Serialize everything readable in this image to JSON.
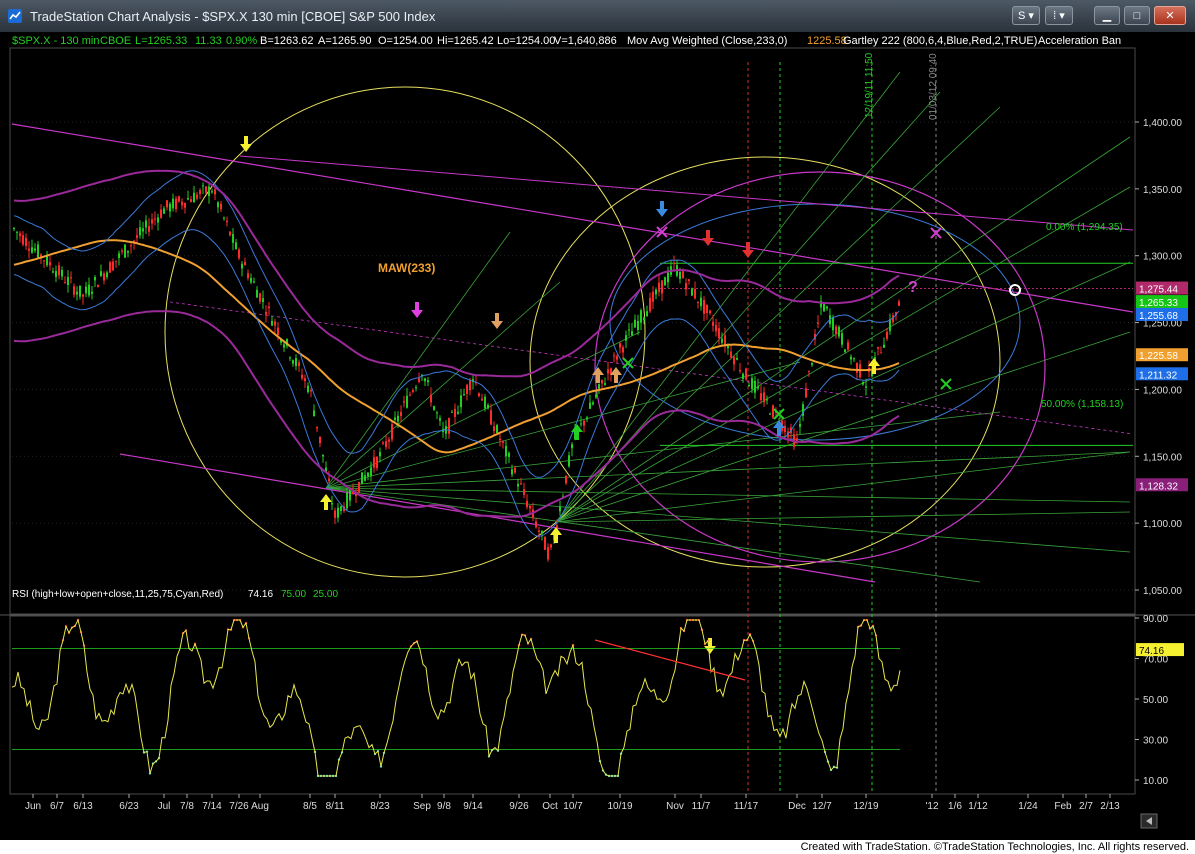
{
  "window": {
    "title": "TradeStation Chart Analysis - $SPX.X 130 min [CBOE] S&P 500 Index",
    "buttons": {
      "symbol_menu": "S ▾",
      "study_menu": "⁞ ▾",
      "minimize": "▁",
      "maximize": "□",
      "close": "✕"
    }
  },
  "header": {
    "symbol": "$SPX.X - 130 min",
    "exchange": "CBOE",
    "last": "L=1265.33",
    "change": "11.33",
    "change_pct": "0.90%",
    "bid": "B=1263.62",
    "ask": "A=1265.90",
    "open": "O=1254.00",
    "high": "Hi=1265.42",
    "low": "Lo=1254.00",
    "volume": "V=1,640,886",
    "mov_avg": "Mov Avg Weighted (Close,233,0)",
    "mov_avg_value": "1225.58",
    "gartley": "Gartley 222 (800,6,4,Blue,Red,2,TRUE)",
    "accel": "Acceleration Ban"
  },
  "price_panel": {
    "labels": {
      "maw": "MAW(233)",
      "fib_top": "0.00% (1,294.35)",
      "fib_mid": "50.00% (1,158.13)",
      "question": "?",
      "vline1": "12/19/11 11:50",
      "vline2": "01/03/12 09:40"
    },
    "axis_ticks": [
      {
        "label": "1,400.00",
        "value": 1400
      },
      {
        "label": "1,350.00",
        "value": 1350
      },
      {
        "label": "1,300.00",
        "value": 1300
      },
      {
        "label": "1,250.00",
        "value": 1250
      },
      {
        "label": "1,200.00",
        "value": 1200
      },
      {
        "label": "1,150.00",
        "value": 1150
      },
      {
        "label": "1,100.00",
        "value": 1100
      },
      {
        "label": "1,050.00",
        "value": 1050
      }
    ],
    "tags": [
      {
        "label": "1,275.44",
        "value": 1275.44,
        "color": "#b02a6a"
      },
      {
        "label": "1,265.33",
        "value": 1265.33,
        "color": "#15c415"
      },
      {
        "label": "1,255.68",
        "value": 1255.68,
        "color": "#1e6ee8"
      },
      {
        "label": "1,225.58",
        "value": 1225.58,
        "color": "#f0a030"
      },
      {
        "label": "1,211.32",
        "value": 1211.32,
        "color": "#1e6ee8"
      },
      {
        "label": "1,128.32",
        "value": 1128.32,
        "color": "#8a1f7a"
      }
    ]
  },
  "rsi_panel": {
    "title": "RSI (high+low+open+close,11,25,75,Cyan,Red)",
    "value": "74.16",
    "overbought": "75.00",
    "oversold": "25.00",
    "axis_ticks": [
      {
        "label": "90.00",
        "value": 90
      },
      {
        "label": "70.00",
        "value": 70
      },
      {
        "label": "50.00",
        "value": 50
      },
      {
        "label": "30.00",
        "value": 30
      },
      {
        "label": "10.00",
        "value": 10
      }
    ],
    "tag": {
      "label": "74.16",
      "value": 74.16
    }
  },
  "x_axis": [
    "Jun",
    "6/7",
    "6/13",
    "6/23",
    "Jul",
    "7/8",
    "7/14",
    "7/26",
    "Aug",
    "8/5",
    "8/11",
    "8/23",
    "Sep",
    "9/8",
    "9/14",
    "9/26",
    "Oct",
    "10/7",
    "10/19",
    "Nov",
    "11/7",
    "11/17",
    "Dec",
    "12/7",
    "12/19",
    "'12",
    "1/6",
    "1/12",
    "1/24",
    "Feb",
    "2/7",
    "2/13"
  ],
  "chart_data": {
    "type": "candlestick",
    "title": "$SPX.X 130 min [CBOE] S&P 500 Index",
    "ylim": [
      1020,
      1440
    ],
    "key_levels": [
      {
        "label": "0.00%",
        "value": 1294.35
      },
      {
        "label": "50.00%",
        "value": 1158.13
      }
    ],
    "anchor_points": [
      {
        "x": "Jun",
        "y": 1320
      },
      {
        "x": "6/13",
        "y": 1270
      },
      {
        "x": "Jul",
        "y": 1335
      },
      {
        "x": "7/14",
        "y": 1350
      },
      {
        "x": "7/26",
        "y": 1300
      },
      {
        "x": "8/5",
        "y": 1200
      },
      {
        "x": "8/11",
        "y": 1105
      },
      {
        "x": "8/23",
        "y": 1150
      },
      {
        "x": "Sep",
        "y": 1215
      },
      {
        "x": "9/8",
        "y": 1165
      },
      {
        "x": "9/14",
        "y": 1210
      },
      {
        "x": "9/26",
        "y": 1130
      },
      {
        "x": "Oct",
        "y": 1075
      },
      {
        "x": "10/7",
        "y": 1160
      },
      {
        "x": "10/19",
        "y": 1230
      },
      {
        "x": "Nov",
        "y": 1292
      },
      {
        "x": "11/7",
        "y": 1265
      },
      {
        "x": "11/17",
        "y": 1210
      },
      {
        "x": "Dec",
        "y": 1160
      },
      {
        "x": "12/7",
        "y": 1265
      },
      {
        "x": "12/19",
        "y": 1205
      },
      {
        "x": "'12",
        "y": 1265
      }
    ],
    "rsi": [
      40,
      55,
      75,
      45,
      30,
      60,
      80,
      68,
      42,
      25,
      15,
      45,
      70,
      55,
      40,
      62,
      78,
      35,
      20,
      70,
      80,
      72,
      55,
      40,
      30,
      78,
      74
    ]
  },
  "status": {
    "text": "Created with TradeStation. ©TradeStation Technologies, Inc. All rights reserved."
  },
  "colors": {
    "bull": "#22d022",
    "bear": "#ff2a2a",
    "maw": "#f0a030",
    "band": "#c838c8",
    "ellipse": "#e8e060",
    "fan": "#3aa43a",
    "rsi": "#e8e84a",
    "blue": "#3a7ad8"
  }
}
